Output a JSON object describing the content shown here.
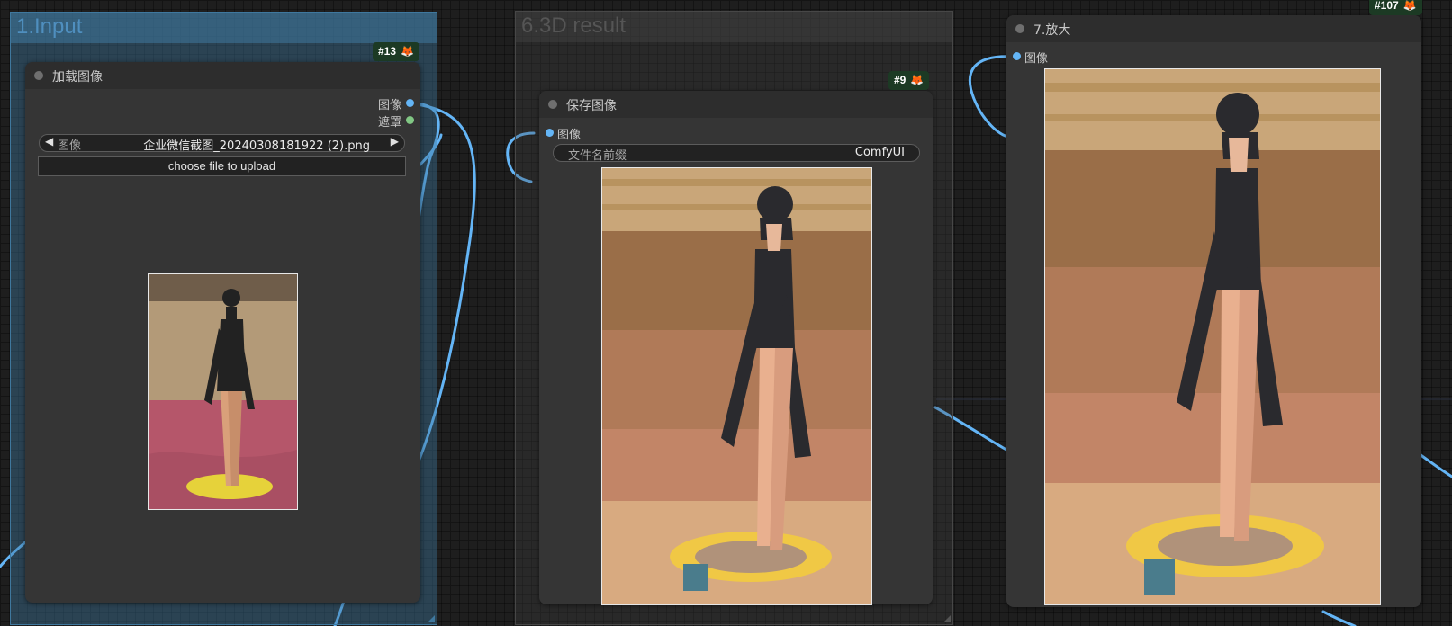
{
  "groups": {
    "input": {
      "title": "1.Input"
    },
    "result3d": {
      "title": "6.3D result"
    }
  },
  "nodes": {
    "load_image": {
      "badge": "#13",
      "title": "加载图像",
      "outputs": [
        {
          "label": "图像",
          "color": "#64b5f6"
        },
        {
          "label": "遮罩",
          "color": "#81c784"
        }
      ],
      "widget_image": {
        "name": "图像",
        "value": "企业微信截图_20240308181922 (2).png"
      },
      "upload_label": "choose file to upload"
    },
    "save_image": {
      "badge": "#9",
      "title": "保存图像",
      "input": {
        "label": "图像",
        "color": "#64b5f6"
      },
      "widget_prefix": {
        "name": "文件名前缀",
        "value": "ComfyUI"
      }
    },
    "upscale": {
      "badge": "#107",
      "title": "7.放大",
      "input": {
        "label": "图像",
        "color": "#64b5f6"
      }
    }
  },
  "colors": {
    "link": "#64b5f6",
    "group_input": "#3f789e",
    "group_result": "#444444",
    "badge_bg": "#1c3a24",
    "fox_icon": "#f08a24"
  },
  "icons": {
    "badge": "fox-icon",
    "prev": "triangle-left-icon",
    "next": "triangle-right-icon"
  }
}
